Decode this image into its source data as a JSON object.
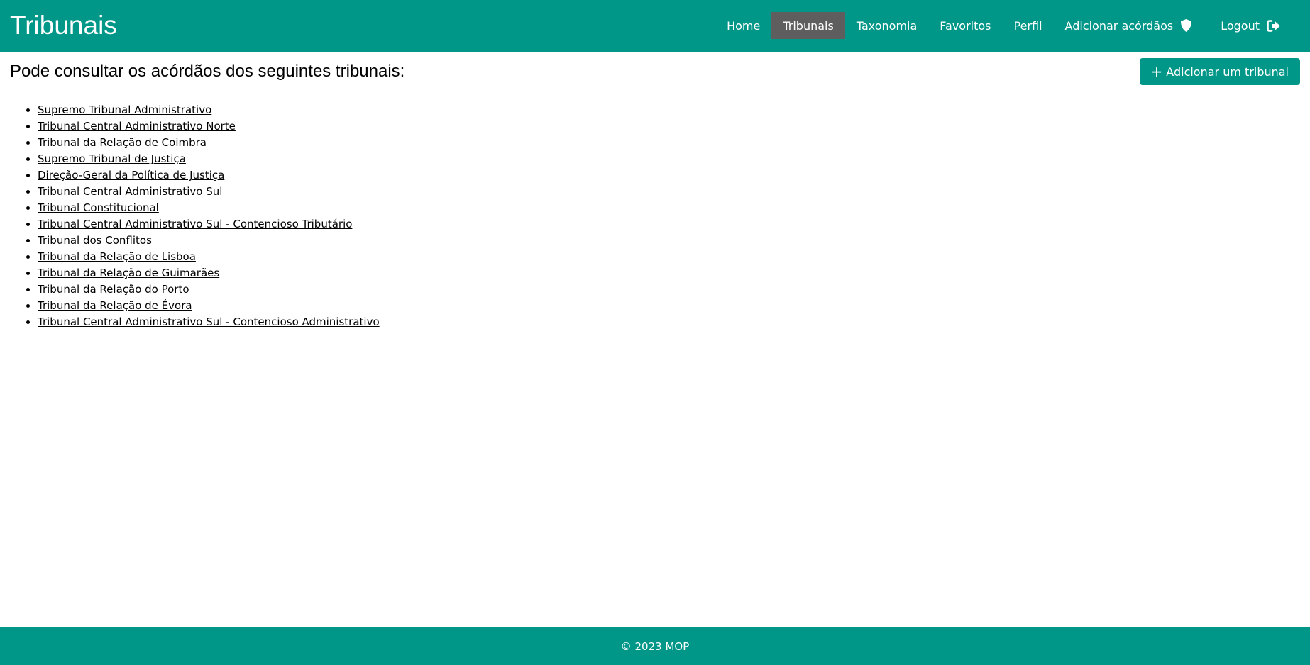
{
  "app": {
    "brand": "Tribunais",
    "accent_color": "#009688",
    "active_tab_color": "#5e5e5e"
  },
  "nav": {
    "items": [
      {
        "label": "Home"
      },
      {
        "label": "Tribunais",
        "active": true
      },
      {
        "label": "Taxonomia"
      },
      {
        "label": "Favoritos"
      },
      {
        "label": "Perfil"
      },
      {
        "label": "Adicionar acórdãos",
        "icon": "shield-icon"
      },
      {
        "label": "Logout",
        "icon": "sign-out-icon"
      }
    ]
  },
  "main": {
    "title": "Pode consultar os acórdãos dos seguintes tribunais:",
    "add_button": {
      "label": "Adicionar um tribunal",
      "icon": "plus-icon"
    },
    "tribunals": [
      "Supremo Tribunal Administrativo",
      "Tribunal Central Administrativo Norte",
      "Tribunal da Relação de Coimbra",
      "Supremo Tribunal de Justiça",
      "Direção-Geral da Política de Justiça",
      "Tribunal Central Administrativo Sul",
      "Tribunal Constitucional",
      "Tribunal Central Administrativo Sul - Contencioso Tributário",
      "Tribunal dos Conflitos",
      "Tribunal da Relação de Lisboa",
      "Tribunal da Relação de Guimarães",
      "Tribunal da Relação do Porto",
      "Tribunal da Relação de Évora",
      "Tribunal Central Administrativo Sul - Contencioso Administrativo"
    ]
  },
  "footer": {
    "text": "© 2023 MOP"
  }
}
